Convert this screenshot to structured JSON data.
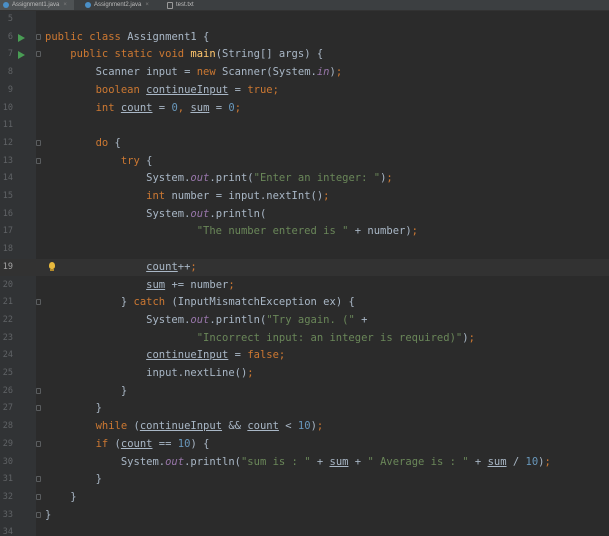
{
  "tabs": [
    {
      "label": "Assignment1.java",
      "active": true,
      "icon": "java-class-icon"
    },
    {
      "label": "Assignment2.java",
      "active": false,
      "icon": "java-class-icon"
    },
    {
      "label": "test.txt",
      "active": false,
      "icon": "text-file-icon"
    }
  ],
  "tab_close_glyph": "×",
  "current_line": 19,
  "lines": [
    {
      "n": "5",
      "tokens": []
    },
    {
      "n": "6",
      "run": true,
      "fold": true,
      "tokens": [
        {
          "t": "public class ",
          "c": "kw"
        },
        {
          "t": "Assignment1 {",
          "c": "pl"
        }
      ]
    },
    {
      "n": "7",
      "run": true,
      "fold": true,
      "tokens": [
        {
          "t": "    "
        },
        {
          "t": "public static void ",
          "c": "kw"
        },
        {
          "t": "main",
          "c": "fn"
        },
        {
          "t": "(String[] args) {",
          "c": "pl"
        }
      ]
    },
    {
      "n": "8",
      "tokens": [
        {
          "t": "        Scanner input = "
        },
        {
          "t": "new ",
          "c": "kw"
        },
        {
          "t": "Scanner(System."
        },
        {
          "t": "in",
          "c": "fi"
        },
        {
          "t": ")"
        },
        {
          "t": ";",
          "c": "kw"
        }
      ]
    },
    {
      "n": "9",
      "tokens": [
        {
          "t": "        "
        },
        {
          "t": "boolean ",
          "c": "kw"
        },
        {
          "t": "continueInput",
          "c": "uv"
        },
        {
          "t": " = "
        },
        {
          "t": "true",
          "c": "kw"
        },
        {
          "t": ";",
          "c": "kw"
        }
      ]
    },
    {
      "n": "10",
      "tokens": [
        {
          "t": "        "
        },
        {
          "t": "int ",
          "c": "kw"
        },
        {
          "t": "count",
          "c": "uv"
        },
        {
          "t": " = "
        },
        {
          "t": "0",
          "c": "nm"
        },
        {
          "t": ", ",
          "c": "kw"
        },
        {
          "t": "sum",
          "c": "uv"
        },
        {
          "t": " = "
        },
        {
          "t": "0",
          "c": "nm"
        },
        {
          "t": ";",
          "c": "kw"
        }
      ]
    },
    {
      "n": "11",
      "tokens": []
    },
    {
      "n": "12",
      "fold": true,
      "tokens": [
        {
          "t": "        "
        },
        {
          "t": "do ",
          "c": "kw"
        },
        {
          "t": "{"
        }
      ]
    },
    {
      "n": "13",
      "fold": true,
      "tokens": [
        {
          "t": "            "
        },
        {
          "t": "try ",
          "c": "kw"
        },
        {
          "t": "{"
        }
      ]
    },
    {
      "n": "14",
      "tokens": [
        {
          "t": "                System."
        },
        {
          "t": "out",
          "c": "fi"
        },
        {
          "t": ".print("
        },
        {
          "t": "\"Enter an integer: \"",
          "c": "st"
        },
        {
          "t": ")"
        },
        {
          "t": ";",
          "c": "kw"
        }
      ]
    },
    {
      "n": "15",
      "tokens": [
        {
          "t": "                "
        },
        {
          "t": "int ",
          "c": "kw"
        },
        {
          "t": "number = input.nextInt()"
        },
        {
          "t": ";",
          "c": "kw"
        }
      ]
    },
    {
      "n": "16",
      "tokens": [
        {
          "t": "                System."
        },
        {
          "t": "out",
          "c": "fi"
        },
        {
          "t": ".println("
        }
      ]
    },
    {
      "n": "17",
      "tokens": [
        {
          "t": "                        "
        },
        {
          "t": "\"The number entered is \"",
          "c": "st"
        },
        {
          "t": " + number)"
        },
        {
          "t": ";",
          "c": "kw"
        }
      ]
    },
    {
      "n": "18",
      "tokens": []
    },
    {
      "n": "19",
      "bulb": true,
      "tokens": [
        {
          "t": "                "
        },
        {
          "t": "count",
          "c": "uv"
        },
        {
          "t": "++"
        },
        {
          "t": ";",
          "c": "kw"
        }
      ]
    },
    {
      "n": "20",
      "tokens": [
        {
          "t": "                "
        },
        {
          "t": "sum",
          "c": "uv"
        },
        {
          "t": " += number"
        },
        {
          "t": ";",
          "c": "kw"
        }
      ]
    },
    {
      "n": "21",
      "fold": true,
      "tokens": [
        {
          "t": "            } "
        },
        {
          "t": "catch ",
          "c": "kw"
        },
        {
          "t": "(InputMismatchException ex) {"
        }
      ]
    },
    {
      "n": "22",
      "tokens": [
        {
          "t": "                System."
        },
        {
          "t": "out",
          "c": "fi"
        },
        {
          "t": ".println("
        },
        {
          "t": "\"Try again. (\"",
          "c": "st"
        },
        {
          "t": " +"
        }
      ]
    },
    {
      "n": "23",
      "tokens": [
        {
          "t": "                        "
        },
        {
          "t": "\"Incorrect input: an integer is required)\"",
          "c": "st"
        },
        {
          "t": ")"
        },
        {
          "t": ";",
          "c": "kw"
        }
      ]
    },
    {
      "n": "24",
      "tokens": [
        {
          "t": "                "
        },
        {
          "t": "continueInput",
          "c": "uv"
        },
        {
          "t": " = "
        },
        {
          "t": "false",
          "c": "kw"
        },
        {
          "t": ";",
          "c": "kw"
        }
      ]
    },
    {
      "n": "25",
      "tokens": [
        {
          "t": "                input.nextLine()"
        },
        {
          "t": ";",
          "c": "kw"
        }
      ]
    },
    {
      "n": "26",
      "fold": true,
      "tokens": [
        {
          "t": "            }"
        }
      ]
    },
    {
      "n": "27",
      "fold": true,
      "tokens": [
        {
          "t": "        }"
        }
      ]
    },
    {
      "n": "28",
      "tokens": [
        {
          "t": "        "
        },
        {
          "t": "while ",
          "c": "kw"
        },
        {
          "t": "("
        },
        {
          "t": "continueInput",
          "c": "uv"
        },
        {
          "t": " && "
        },
        {
          "t": "count",
          "c": "uv"
        },
        {
          "t": " < "
        },
        {
          "t": "10",
          "c": "nm"
        },
        {
          "t": ")"
        },
        {
          "t": ";",
          "c": "kw"
        }
      ]
    },
    {
      "n": "29",
      "fold": true,
      "tokens": [
        {
          "t": "        "
        },
        {
          "t": "if ",
          "c": "kw"
        },
        {
          "t": "("
        },
        {
          "t": "count",
          "c": "uv"
        },
        {
          "t": " == "
        },
        {
          "t": "10",
          "c": "nm"
        },
        {
          "t": ") {"
        }
      ]
    },
    {
      "n": "30",
      "tokens": [
        {
          "t": "            System."
        },
        {
          "t": "out",
          "c": "fi"
        },
        {
          "t": ".println("
        },
        {
          "t": "\"sum is : \"",
          "c": "st"
        },
        {
          "t": " + "
        },
        {
          "t": "sum",
          "c": "uv"
        },
        {
          "t": " + "
        },
        {
          "t": "\" Average is : \"",
          "c": "st"
        },
        {
          "t": " + "
        },
        {
          "t": "sum",
          "c": "uv"
        },
        {
          "t": " / "
        },
        {
          "t": "10",
          "c": "nm"
        },
        {
          "t": ")"
        },
        {
          "t": ";",
          "c": "kw"
        }
      ]
    },
    {
      "n": "31",
      "fold": true,
      "tokens": [
        {
          "t": "        }"
        }
      ]
    },
    {
      "n": "32",
      "fold": true,
      "tokens": [
        {
          "t": "    }"
        }
      ]
    },
    {
      "n": "33",
      "fold": true,
      "tokens": [
        {
          "t": "}"
        }
      ]
    },
    {
      "n": "34",
      "tokens": []
    }
  ],
  "colors": {
    "background": "#2b2b2b",
    "keyword": "#cc7832",
    "string": "#6a8759",
    "number": "#6897bb",
    "field": "#9876aa",
    "method": "#ffc66d",
    "plain": "#a9b7c6",
    "run": "#499c54",
    "bulb": "#e8b93d"
  }
}
